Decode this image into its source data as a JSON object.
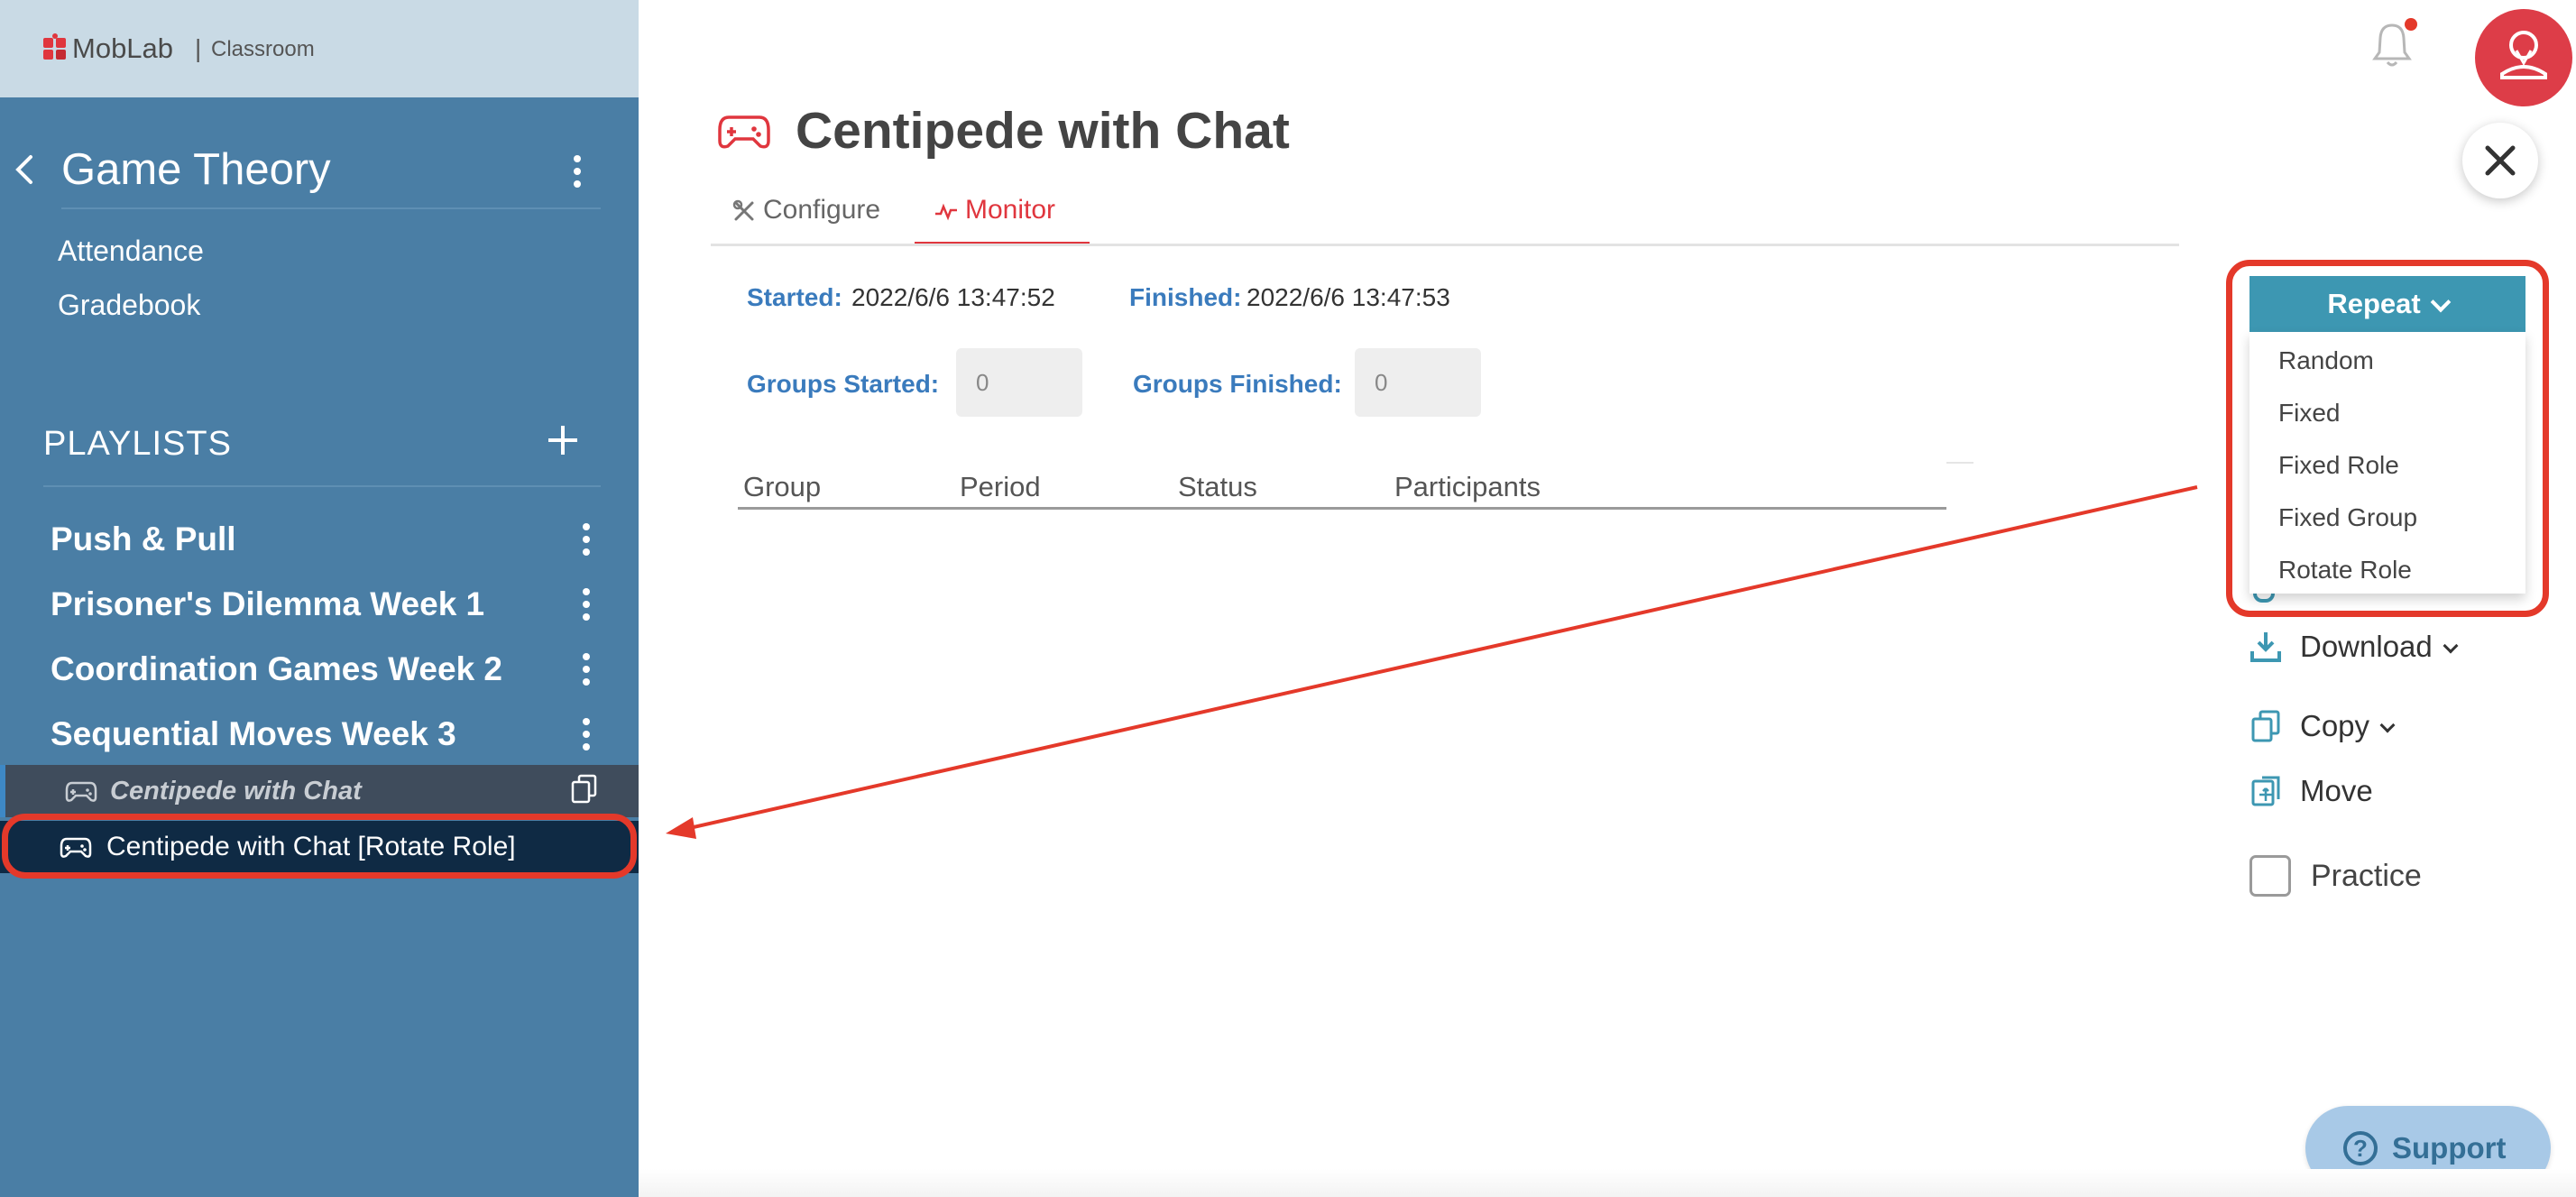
{
  "app": {
    "brand": "MobLab",
    "separator": "|",
    "product": "Classroom"
  },
  "sidebar": {
    "course_title": "Game Theory",
    "links": [
      "Attendance",
      "Gradebook"
    ],
    "playlists_header": "PLAYLISTS",
    "playlists": [
      "Push & Pull",
      "Prisoner's Dilemma Week 1",
      "Coordination Games Week 2",
      "Sequential Moves Week 3"
    ],
    "games": [
      {
        "label": "Centipede with Chat",
        "state": "active"
      },
      {
        "label": "Centipede with Chat [Rotate Role]",
        "state": "selected"
      }
    ]
  },
  "header": {
    "game_title": "Centipede with Chat"
  },
  "tabs": [
    {
      "label": "Configure",
      "active": false
    },
    {
      "label": "Monitor",
      "active": true
    }
  ],
  "meta": {
    "started_label": "Started:",
    "started_value": "2022/6/6 13:47:52",
    "finished_label": "Finished:",
    "finished_value": "2022/6/6 13:47:53",
    "groups_started_label": "Groups Started:",
    "groups_started_value": "0",
    "groups_finished_label": "Groups Finished:",
    "groups_finished_value": "0"
  },
  "table": {
    "columns": [
      "Group",
      "Period",
      "Status",
      "Participants"
    ],
    "rows": []
  },
  "actions": {
    "repeat_label": "Repeat",
    "repeat_options": [
      "Random",
      "Fixed",
      "Fixed Role",
      "Fixed Group",
      "Rotate Role"
    ],
    "download_label": "Download",
    "copy_label": "Copy",
    "move_label": "Move",
    "practice_label": "Practice",
    "practice_checked": false
  },
  "support": {
    "label": "Support"
  },
  "colors": {
    "sidebar_bg": "#4a7ea5",
    "brand_bg": "#c9dae5",
    "accent_red": "#e0363e",
    "link_blue": "#3a7bbd",
    "repeat_teal": "#3d97b2",
    "annotation_red": "#e4392a"
  },
  "icons": [
    "moblab-logo-icon",
    "chevron-left-icon",
    "kebab-menu-icon",
    "plus-icon",
    "gamepad-icon",
    "copy-icon",
    "bell-icon",
    "user-avatar-icon",
    "close-icon",
    "wrench-icon",
    "pulse-icon",
    "download-icon",
    "move-icon",
    "question-icon"
  ]
}
